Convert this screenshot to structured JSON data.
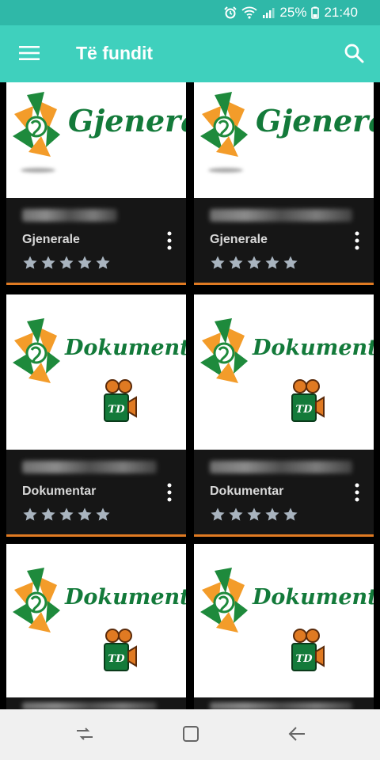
{
  "status": {
    "battery": "25%",
    "time": "21:40"
  },
  "appbar": {
    "title": "Të fundit"
  },
  "cards": [
    {
      "brand": "Gjenerale",
      "title": "Gjenerale"
    },
    {
      "brand": "Gjenerale",
      "title": "Gjenerale"
    },
    {
      "brand": "Dokumentar",
      "title": "Dokumentar"
    },
    {
      "brand": "Dokumentar",
      "title": "Dokumentar"
    },
    {
      "brand": "Dokumentar",
      "title": ""
    },
    {
      "brand": "Dokumentar",
      "title": ""
    }
  ],
  "rating_stars": 5,
  "camera_label": "TD",
  "colors": {
    "appbar": "#3fd0bd",
    "statusbar": "#2fb8a8",
    "accent_line": "#e07a22",
    "brand_green": "#137a3a",
    "star": "#a9b4bf"
  },
  "icons": [
    "alarm-icon",
    "wifi-icon",
    "signal-icon",
    "battery-icon",
    "menu-icon",
    "search-icon",
    "star-icon",
    "more-vert-icon",
    "camera-icon",
    "recents-icon",
    "home-icon",
    "back-icon"
  ]
}
